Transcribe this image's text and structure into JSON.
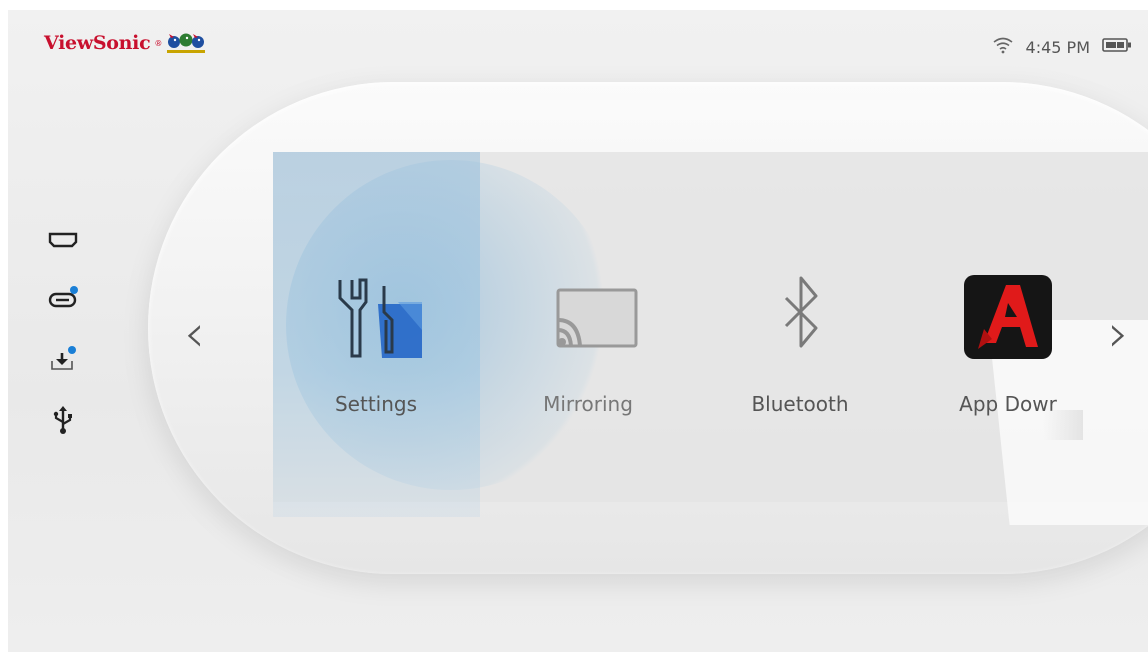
{
  "brand": {
    "name": "ViewSonic",
    "reg": "®"
  },
  "status": {
    "time": "4:45 PM",
    "wifi_icon": "wifi-icon",
    "battery_icon": "battery-icon"
  },
  "sidebar": {
    "items": [
      {
        "name": "hdmi-input",
        "icon": "hdmi-icon"
      },
      {
        "name": "usb-c-input",
        "icon": "usb-c-icon"
      },
      {
        "name": "download",
        "icon": "download-icon"
      },
      {
        "name": "usb-reader",
        "icon": "usb-icon"
      }
    ]
  },
  "apps": [
    {
      "label": "Settings",
      "icon": "settings-icon",
      "selected": true
    },
    {
      "label": "Mirroring",
      "icon": "cast-icon",
      "selected": false
    },
    {
      "label": "Bluetooth",
      "icon": "bluetooth-icon",
      "selected": false
    },
    {
      "label": "App Dowr",
      "icon": "app-store-icon",
      "selected": false
    }
  ],
  "colors": {
    "brand_red": "#c8102e",
    "accent_blue": "#1a7fd6",
    "selection": "#9ec3de"
  }
}
